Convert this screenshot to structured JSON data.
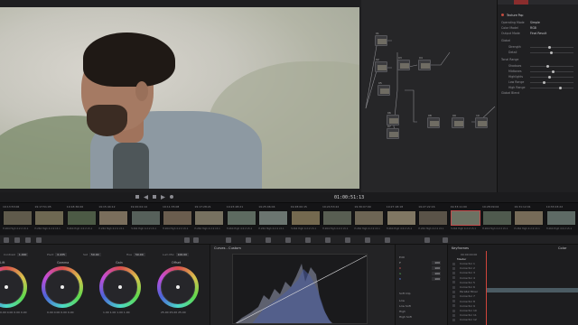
{
  "viewer": {
    "timecode": "01:00:51:13"
  },
  "nodes": [
    {
      "id": "01",
      "label": "01"
    },
    {
      "id": "02",
      "label": "02"
    },
    {
      "id": "03",
      "label": "03"
    },
    {
      "id": "04",
      "label": "04"
    },
    {
      "id": "05",
      "label": "05"
    },
    {
      "id": "06",
      "label": "06"
    },
    {
      "id": "07",
      "label": "07"
    },
    {
      "id": "08",
      "label": "08"
    },
    {
      "id": "09",
      "label": "09"
    },
    {
      "id": "10",
      "label": "10"
    }
  ],
  "inspector": {
    "title": "Texture Pop",
    "rows": [
      {
        "label": "Operating Mode",
        "value": "Simple"
      },
      {
        "label": "Color Model",
        "value": "RGB"
      },
      {
        "label": "Output Mode",
        "value": "Final Result"
      }
    ],
    "sections": [
      "Global",
      "Tonal Range",
      "Global Blend"
    ],
    "sliders": [
      "Strength",
      "Detail",
      "Shadows",
      "Midtones",
      "Highlights",
      "Low Range",
      "High Range"
    ]
  },
  "clips": [
    {
      "num": "01",
      "tc": "19:13:53:06",
      "name": "H.264 High 4:2:2 L5.1"
    },
    {
      "num": "02",
      "tc": "19:17:51:05",
      "name": "H.264 High 4:2:2 L5.1"
    },
    {
      "num": "03",
      "tc": "19:18:36:06",
      "name": "H.264 High 4:2:2 L5.1"
    },
    {
      "num": "04",
      "tc": "19:15:44:12",
      "name": "H.264 High 4:2:2 L5.1"
    },
    {
      "num": "05",
      "tc": "19:20:04:14",
      "name": "H.264 High 4:2:2 L5.1"
    },
    {
      "num": "06",
      "tc": "19:11:35:08",
      "name": "H.264 High 4:2:2 L5.1"
    },
    {
      "num": "07",
      "tc": "19:17:28:21",
      "name": "H.264 High 4:2:2 L5.1"
    },
    {
      "num": "08",
      "tc": "19:23:28:21",
      "name": "H.264 High 4:2:2 L5.1"
    },
    {
      "num": "09",
      "tc": "19:25:06:04",
      "name": "H.264 High 4:2:2 L5.1"
    },
    {
      "num": "10",
      "tc": "19:28:00:15",
      "name": "H.264 High 4:2:2 L5.1"
    },
    {
      "num": "11",
      "tc": "19:24:53:22",
      "name": "H.264 High 4:2:2 L5.1"
    },
    {
      "num": "12",
      "tc": "19:30:07:09",
      "name": "H.264 High 4:2:2 L5.1"
    },
    {
      "num": "13",
      "tc": "19:27:18:18",
      "name": "H.264 High 4:2:2 L5.1"
    },
    {
      "num": "14",
      "tc": "19:27:22:16",
      "name": "H.264 High 4:2:2 L5.1"
    },
    {
      "num": "15",
      "tc": "19:33:11:00",
      "name": "H.264 High 4:2:2 L5.1"
    },
    {
      "num": "16",
      "tc": "19:28:09:04",
      "name": "H.264 High 4:2:2 L5.1"
    },
    {
      "num": "17",
      "tc": "19:31:12:01",
      "name": "H.264 High 4:2:2 L5.1"
    },
    {
      "num": "18",
      "tc": "19:33:03:22",
      "name": "H.264 High 4:2:2 L5.1"
    }
  ],
  "primaries": {
    "fields": [
      {
        "label": "Contrast",
        "value": "1.000"
      },
      {
        "label": "Pivot",
        "value": "0.435"
      },
      {
        "label": "Sat",
        "value": "50.00"
      },
      {
        "label": "Hue",
        "value": "50.00"
      },
      {
        "label": "Lum Mix",
        "value": "100.00"
      }
    ],
    "wheels": [
      {
        "name": "Lift",
        "values": "0.00  0.00  0.00  0.00"
      },
      {
        "name": "Gamma",
        "values": "0.00  0.00  0.00  0.00"
      },
      {
        "name": "Gain",
        "values": "1.00  1.00  1.00  1.00"
      },
      {
        "name": "Offset",
        "values": "25.00  25.00  25.00"
      }
    ]
  },
  "curves": {
    "title": "Curves - Custom",
    "edit_label": "Edit",
    "soft_clip_label": "Soft Clip",
    "channels": [
      {
        "name": "Y",
        "value": "100"
      },
      {
        "name": "R",
        "value": "100"
      },
      {
        "name": "G",
        "value": "100"
      },
      {
        "name": "B",
        "value": "100"
      }
    ],
    "soft_clip_rows": [
      "Low",
      "Low Soft",
      "High",
      "High Soft"
    ]
  },
  "keyframes": {
    "title": "Keyframes",
    "right_label": "Color",
    "master_label": "Master",
    "timecode": "00:00:00:00",
    "rows": [
      "Corrector 1",
      "Corrector 2",
      "Corrector 3",
      "Corrector 4",
      "Corrector 5",
      "Corrector 6",
      "Parallel Mixer",
      "Corrector 7",
      "Corrector 8",
      "Corrector 9",
      "Corrector 10",
      "Corrector 11",
      "Corrector 12"
    ]
  },
  "colors": {
    "accent_red": "#d0453b",
    "selection": "#c24a4a"
  }
}
